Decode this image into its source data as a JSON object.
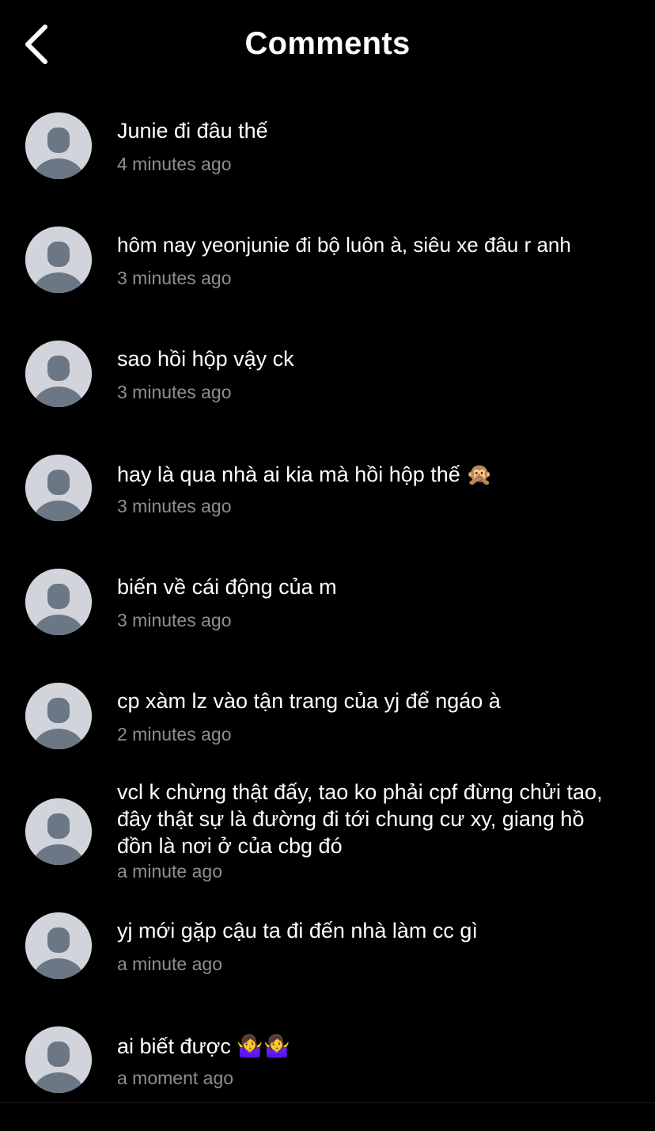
{
  "header": {
    "title": "Comments",
    "back_icon": "chevron-left-icon"
  },
  "avatar_icon": "default-user-avatar-icon",
  "colors": {
    "background": "#000000",
    "text": "#ffffff",
    "timestamp": "#8e8e93",
    "avatar_bg": "#d1d5db",
    "avatar_figure": "#6b7785"
  },
  "comments": [
    {
      "text": "Junie đi đâu thế",
      "time": "4 minutes ago"
    },
    {
      "text": "hôm nay yeonjunie đi bộ luôn à, siêu xe đâu r anh",
      "time": "3 minutes ago"
    },
    {
      "text": "sao hồi hộp vậy ck",
      "time": "3 minutes ago"
    },
    {
      "text": "hay là qua nhà ai kia mà hồi hộp thế 🙊",
      "time": "3 minutes ago"
    },
    {
      "text": "biến về cái động của m",
      "time": "3 minutes ago"
    },
    {
      "text": "cp xàm lz vào tận trang của yj để ngáo à",
      "time": "2 minutes ago"
    },
    {
      "text": "vcl k chừng thật đấy, tao ko phải cpf đừng chửi tao, đây thật sự là đường đi tới chung cư xy, giang hồ đồn là nơi ở của cbg đó",
      "time": "a minute ago"
    },
    {
      "text": "yj mới gặp cậu ta đi đến nhà làm cc gì",
      "time": "a minute ago"
    },
    {
      "text": "ai biết được 🤷‍♀️🤷‍♀️",
      "time": "a moment ago"
    }
  ]
}
